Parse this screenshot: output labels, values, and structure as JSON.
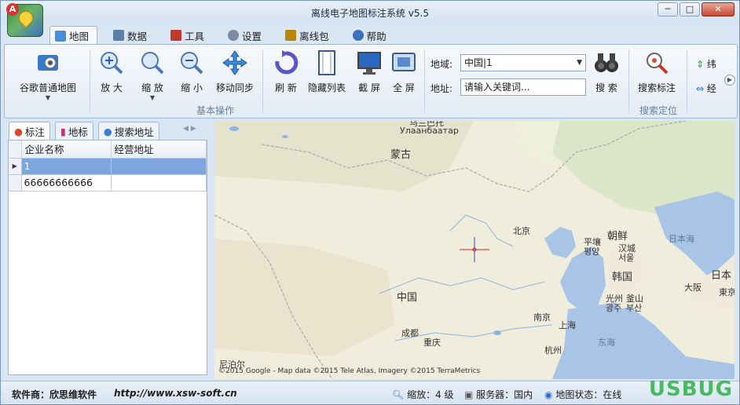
{
  "window": {
    "title": "离线电子地图标注系统 v5.5",
    "controls": [
      "─",
      "□",
      "✕"
    ]
  },
  "app_icon_badge": "A",
  "tabs": [
    {
      "label": "地图",
      "icon": "map-tab-icon",
      "color": "#4a8ed8",
      "active": true
    },
    {
      "label": "数据",
      "icon": "data-table-icon",
      "color": "#5b7fa8"
    },
    {
      "label": "工具",
      "icon": "tools-icon",
      "color": "#c0392b"
    },
    {
      "label": "设置",
      "icon": "settings-icon",
      "color": "#7a8aa0"
    },
    {
      "label": "离线包",
      "icon": "offline-package-icon",
      "color": "#b8860b"
    },
    {
      "label": "帮助",
      "icon": "help-icon",
      "color": "#3a6fc4"
    }
  ],
  "ribbon": {
    "map_type_label": "谷歌普通地图",
    "zoom_in": "放 大",
    "zoom_drag": "缩 放",
    "zoom_out": "缩 小",
    "move_sync": "移动同步",
    "refresh": "刷 新",
    "hide_list": "隐藏列表",
    "screenshot": "截 屏",
    "fullscreen": "全 屏",
    "basic_ops_group": "基本操作",
    "region_label": "地域:",
    "region_value": "中国|1",
    "address_label": "地址:",
    "address_placeholder": "请输入关键词...",
    "search": "搜 索",
    "search_mark": "搜索标注",
    "latitude": "纬",
    "longitude": "经",
    "search_group": "搜索定位"
  },
  "left_tabs": [
    {
      "label": "标注",
      "icon": "marker-pin-icon",
      "color": "#d94a2a"
    },
    {
      "label": "地标",
      "icon": "landmark-book-icon",
      "color": "#c2337a"
    },
    {
      "label": "搜索地址",
      "icon": "search-bubble-icon",
      "color": "#3a7fd4"
    }
  ],
  "grid": {
    "columns": [
      "企业名称",
      "经营地址"
    ],
    "rows": [
      {
        "name": "1",
        "address": ""
      },
      {
        "name": "66666666666",
        "address": ""
      }
    ]
  },
  "map": {
    "labels": {
      "ulaanbaatar_cn": "乌兰巴托",
      "ulaanbaatar_mn": "Улаанбаатар",
      "mongolia": "蒙古",
      "china": "中国",
      "beijing": "北京",
      "pyongyang_cn": "平壤",
      "pyongyang_kr": "평양",
      "north_korea": "朝鲜",
      "seoul_cn": "汉城",
      "seoul_kr": "서울",
      "south_korea": "韩国",
      "gwangju_cn": "光州",
      "gwangju_kr": "광주",
      "busan_cn": "釜山",
      "busan_kr": "부산",
      "sea_of_japan": "日本海",
      "japan": "日本",
      "osaka": "大阪",
      "tokyo": "東京",
      "chengdu": "成都",
      "chongqing": "重庆",
      "nanjing": "南京",
      "shanghai": "上海",
      "hangzhou": "杭州",
      "east_china_sea": "东海",
      "nepal": "尼泊尔",
      "attribution": "©2015 Google - Map data ©2015 Tele Atlas, Imagery ©2015 TerraMetrics"
    }
  },
  "status": {
    "vendor": "软件商：欣思维软件",
    "url": "http://www.xsw-soft.cn",
    "zoom": "缩放：4 级",
    "server": "服务器：国内",
    "map_state": "地图状态：在线",
    "watermark": "USBUG"
  }
}
